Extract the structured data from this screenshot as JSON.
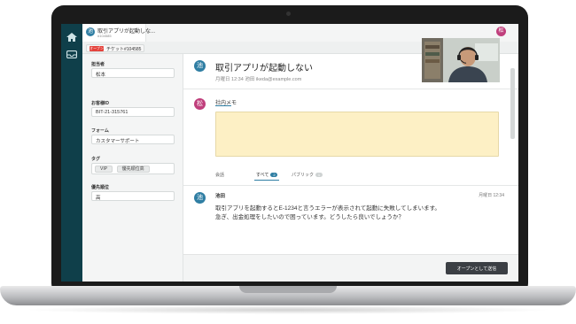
{
  "tab": {
    "title": "取引アプリが起動しな...",
    "subtitle": "#104585",
    "avatar": "池"
  },
  "ticket_bar": {
    "status": "オープン",
    "ticket_label": "チケット#104585"
  },
  "user": {
    "avatar": "松"
  },
  "sidebar": {
    "assignee_label": "担当者",
    "assignee_value": "松本",
    "customer_id_label": "お客様ID",
    "customer_id_value": "BIT-21-315761",
    "form_label": "フォーム",
    "form_value": "カスタマーサポート",
    "tags_label": "タグ",
    "tags": [
      "VIP",
      "優先順位高"
    ],
    "priority_label": "優先順位",
    "priority_value": "高"
  },
  "ticket": {
    "avatar": "池",
    "title": "取引アプリが起動しない",
    "meta": "月曜日 12:34 池田 ikeda@example.com"
  },
  "memo": {
    "avatar": "松",
    "label": "社内メモ"
  },
  "filters": {
    "chat": "会話",
    "all": "すべて",
    "all_count": "2",
    "public": "パブリック",
    "public_count": "1"
  },
  "message": {
    "avatar": "池",
    "name": "池田",
    "time": "月曜日 12:34",
    "line1": "取引アプリを起動するとE-1234と言うエラーが表示されて起動に失敗してしまいます。",
    "line2": "急ぎ、出金処理をしたいので困っています。どうしたら良いでしょうか？"
  },
  "footer": {
    "send_label": "オープンとして送信"
  },
  "colors": {
    "rail": "#0f3f4a",
    "accent": "#2f7ea3",
    "memo_bg": "#fdf0c5",
    "status_red": "#e4423b",
    "user_avatar": "#c03f7c"
  }
}
